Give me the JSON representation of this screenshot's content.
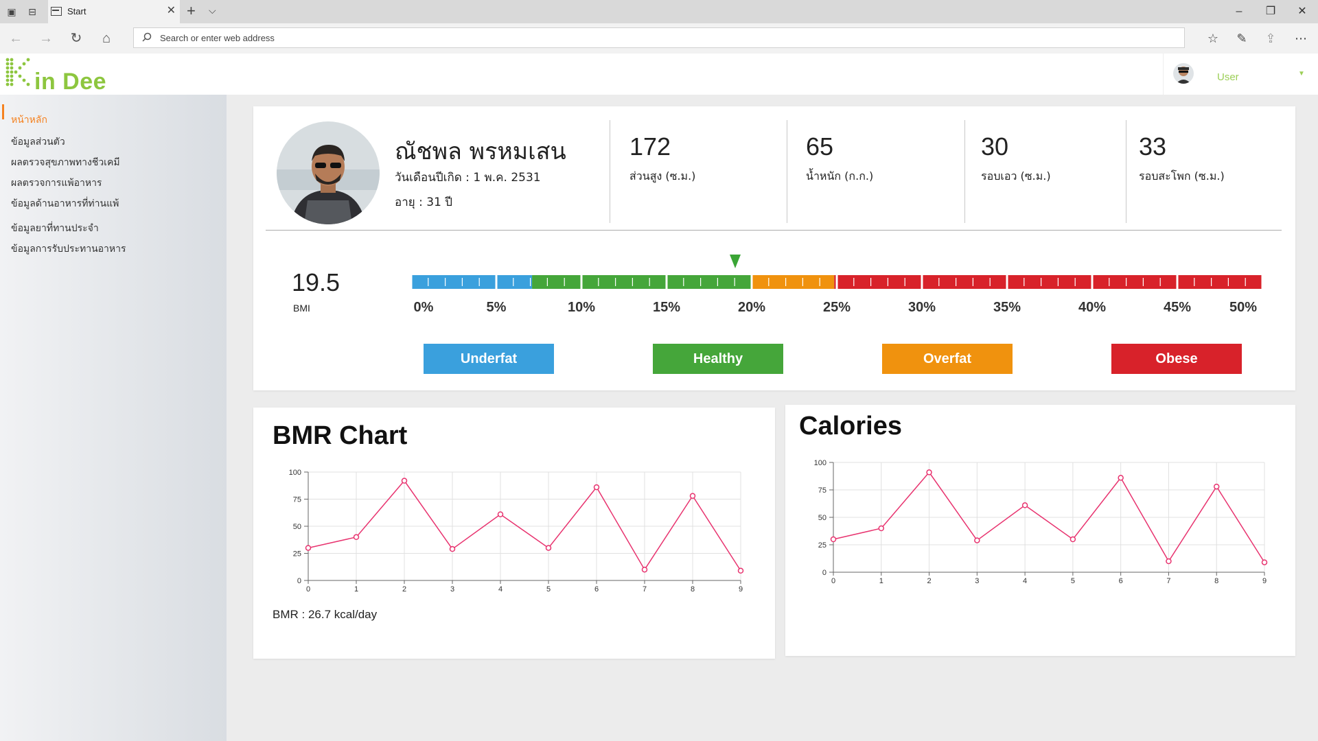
{
  "browser": {
    "tab_title": "Start",
    "address_placeholder": "Search or enter web address"
  },
  "app": {
    "logo_text": "in Dee",
    "user_name": "User"
  },
  "sidebar": {
    "items": [
      {
        "label": "หน้าหลัก",
        "active": true
      },
      {
        "label": "ข้อมูลส่วนตัว"
      },
      {
        "label": "ผลตรวจสุขภาพทางชีวเคมี"
      },
      {
        "label": "ผลตรวจการแพ้อาหาร"
      },
      {
        "label": "ข้อมูลด้านอาหารที่ท่านแพ้"
      },
      {
        "label": "ข้อมูลยาที่ทานประจำ"
      },
      {
        "label": "ข้อมูลการรับประทานอาหาร"
      }
    ]
  },
  "profile": {
    "name": "ณัชพล พรหมเสน",
    "birth": "วันเดือนปีเกิด : 1 พ.ค. 2531",
    "age": "อายุ : 31 ปี",
    "stats": [
      {
        "value": "172",
        "label": "ส่วนสูง (ซ.ม.)"
      },
      {
        "value": "65",
        "label": "น้ำหนัก (ก.ก.)"
      },
      {
        "value": "30",
        "label": "รอบเอว (ซ.ม.)"
      },
      {
        "value": "33",
        "label": "รอบสะโพก (ซ.ม.)"
      }
    ]
  },
  "bmi": {
    "value": "19.5",
    "label": "BMI",
    "marker_percent": 19.5,
    "scale_labels": [
      "0%",
      "5%",
      "10%",
      "15%",
      "20%",
      "25%",
      "30%",
      "35%",
      "40%",
      "45%",
      "50%"
    ],
    "categories": [
      {
        "label": "Underfat",
        "color": "#3aa0dd"
      },
      {
        "label": "Healthy",
        "color": "#45a63a"
      },
      {
        "label": "Overfat",
        "color": "#f0920e"
      },
      {
        "label": "Obese",
        "color": "#d8222a"
      }
    ]
  },
  "bmr": {
    "title": "BMR Chart",
    "note": "BMR : 26.7 kcal/day"
  },
  "calories": {
    "title": "Calories"
  },
  "chart_data": [
    {
      "type": "line",
      "title": "BMR Chart",
      "x": [
        0,
        1,
        2,
        3,
        4,
        5,
        6,
        7,
        8,
        9
      ],
      "y_ticks": [
        0,
        25,
        50,
        75,
        100
      ],
      "ylim": [
        0,
        100
      ],
      "grid": true,
      "color": "#e8336f",
      "series": [
        {
          "values": [
            30,
            40,
            92,
            29,
            61,
            30,
            86,
            10,
            78,
            9
          ]
        }
      ]
    },
    {
      "type": "line",
      "title": "Calories",
      "x": [
        0,
        1,
        2,
        3,
        4,
        5,
        6,
        7,
        8,
        9
      ],
      "y_ticks": [
        0,
        25,
        50,
        75,
        100
      ],
      "ylim": [
        0,
        100
      ],
      "grid": true,
      "color": "#e8336f",
      "series": [
        {
          "values": [
            30,
            40,
            91,
            29,
            61,
            30,
            86,
            10,
            78,
            9
          ]
        }
      ]
    }
  ]
}
